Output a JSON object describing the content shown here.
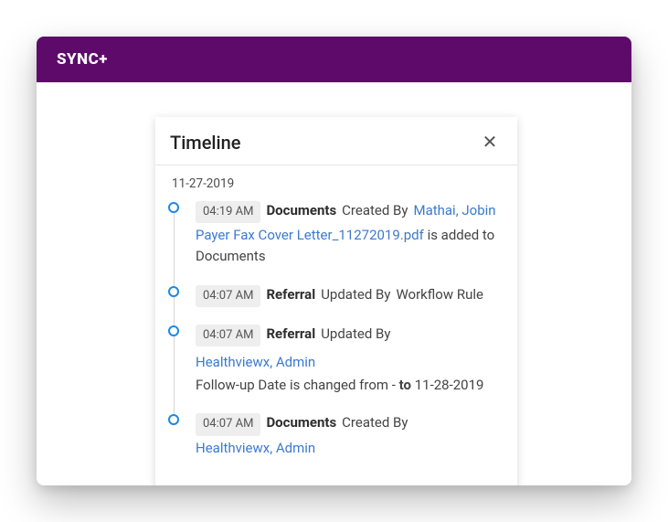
{
  "app": {
    "brand": "SYNC+"
  },
  "panel": {
    "title": "Timeline",
    "date": "11-27-2019"
  },
  "items": [
    {
      "time": "04:19 AM",
      "category": "Documents",
      "prefix": "Created By",
      "actor": "Mathai, Jobin",
      "detail_link": "Payer Fax Cover Letter_11272019.pdf",
      "detail_tail": " is added to Documents"
    },
    {
      "time": "04:07 AM",
      "category": "Referral",
      "prefix": "Updated By",
      "tail": "Workflow Rule"
    },
    {
      "time": "04:07 AM",
      "category": "Referral",
      "prefix": "Updated By",
      "actor": "Healthviewx, Admin",
      "detail_pre": "Follow-up Date is changed from - ",
      "detail_bold": "to",
      "detail_post": " 11-28-2019"
    },
    {
      "time": "04:07 AM",
      "category": "Documents",
      "prefix": "Created By",
      "actor_trunc": "Healthviewx, Admin"
    }
  ]
}
